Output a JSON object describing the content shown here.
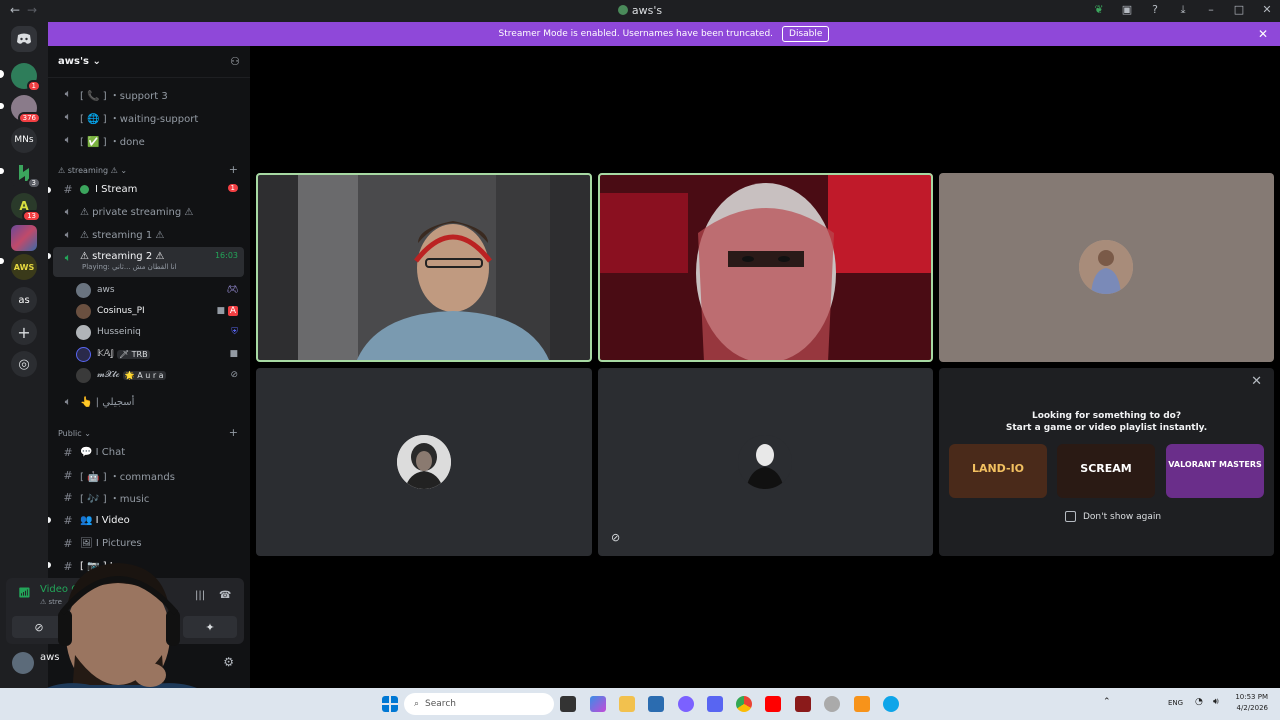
{
  "window": {
    "title": "aws's",
    "back_label": "←",
    "forward_label": "→"
  },
  "banner": {
    "text": "Streamer Mode is enabled. Usernames have been truncated.",
    "button_label": "Disable"
  },
  "servers": [
    {
      "name": "discord-home",
      "initials": ""
    },
    {
      "name": "server-1",
      "badge": "1"
    },
    {
      "name": "server-2",
      "badge": "376"
    },
    {
      "name": "server-mns",
      "initials": "MNs"
    },
    {
      "name": "server-green",
      "badge": "3"
    },
    {
      "name": "server-5",
      "badge": "13"
    },
    {
      "name": "server-6"
    },
    {
      "name": "server-aws"
    },
    {
      "name": "server-as",
      "initials": "as"
    }
  ],
  "guild": {
    "name": "aws's",
    "chevron": "⌄"
  },
  "channels": {
    "top": [
      {
        "label": "[ 📞 ] ・support 3"
      },
      {
        "label": "[ 🌐 ] ・waiting-support"
      },
      {
        "label": "[ ✅ ] ・done"
      }
    ],
    "streaming_category": "⚠ streaming ⚠",
    "streaming": [
      {
        "label": "I Stream",
        "badge": "1"
      },
      {
        "label": "⚠ private streaming ⚠"
      },
      {
        "label": "⚠ streaming 1 ⚠"
      },
      {
        "label": "⚠ streaming 2 ⚠",
        "time": "16:03",
        "sub": "Playing: انا القطان مش ...ثاني"
      }
    ],
    "voice_members": [
      {
        "name": "aws"
      },
      {
        "name": "Cosinus_PI"
      },
      {
        "name": "Husseiniq"
      },
      {
        "name": "𝕂𝔸𝕁",
        "tag": "🗡 TRB"
      },
      {
        "name": "𝓶𝓧𝓽𝓬",
        "tag": "🌟 A u r a"
      }
    ],
    "after_voice": [
      {
        "label": "👆 | أسجيلي"
      }
    ],
    "public_category": "Public",
    "public": [
      {
        "label": "💬 I Chat"
      },
      {
        "label": "[ 🤖 ] ・commands"
      },
      {
        "label": "[ 🎶 ] ・music"
      },
      {
        "label": "👥 I Video"
      },
      {
        "label": "🖼 I Pictures"
      },
      {
        "label": "[ 📷 ] I"
      }
    ]
  },
  "voice_panel": {
    "title": "Video Co",
    "subtitle": "⚠ stre"
  },
  "user_panel": {
    "name": "aws"
  },
  "activity": {
    "line1": "Looking for something to do?",
    "line2": "Start a game or video playlist instantly.",
    "cards": [
      {
        "title": "LAND-IO",
        "bg": "#4a2a1a"
      },
      {
        "title": "SCREAM",
        "bg": "#2a1a14"
      },
      {
        "title": "VALORANT MASTERS",
        "bg": "#6a2e8a"
      }
    ],
    "dont_show_again": "Don't show again"
  },
  "taskbar": {
    "search_placeholder": "Search",
    "language": "ENG",
    "time": "10:53 PM",
    "date": "4/2/2026"
  },
  "colors": {
    "accent_banner": "#8f48d9",
    "speaking_outline": "#a7d9a3",
    "online": "#23a559",
    "unread_badge": "#f23f43"
  }
}
